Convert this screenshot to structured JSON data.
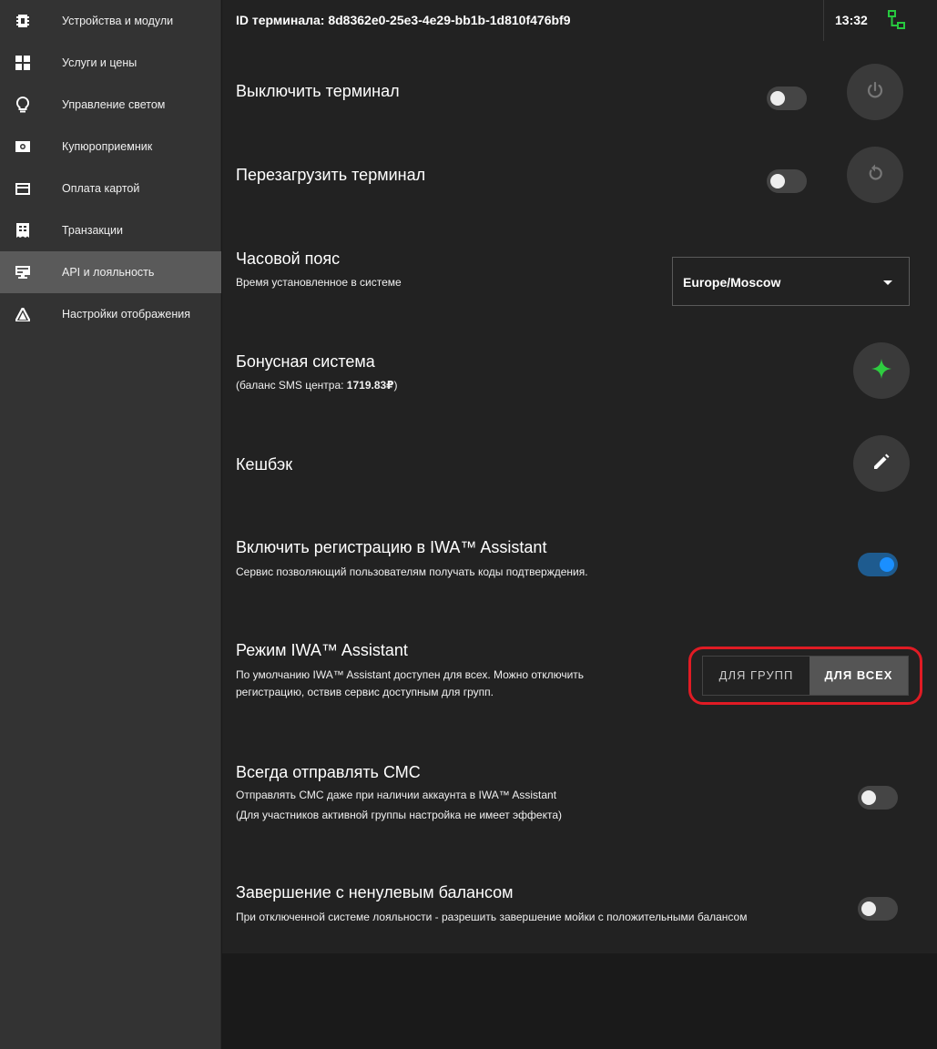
{
  "sidebar": {
    "items": [
      {
        "label": "Устройства и модули",
        "icon": "chip-icon",
        "active": false
      },
      {
        "label": "Услуги и цены",
        "icon": "grid-icon",
        "active": false
      },
      {
        "label": "Управление светом",
        "icon": "lightbulb-icon",
        "active": false
      },
      {
        "label": "Купюроприемник",
        "icon": "banknote-icon",
        "active": false
      },
      {
        "label": "Оплата картой",
        "icon": "credit-card-icon",
        "active": false
      },
      {
        "label": "Транзакции",
        "icon": "receipt-icon",
        "active": false
      },
      {
        "label": "API и лояльность",
        "icon": "api-icon",
        "active": true
      },
      {
        "label": "Настройки отображения",
        "icon": "display-settings-icon",
        "active": false
      }
    ]
  },
  "header": {
    "terminal_id": "ID терминала: 8d8362e0-25e3-4e29-bb1b-1d810f476bf9",
    "time": "13:32",
    "network_icon": "network-connected-icon",
    "network_color": "#27c93f"
  },
  "settings": {
    "shutdown": {
      "title": "Выключить терминал",
      "toggle_on": false,
      "button_icon": "power-icon"
    },
    "reboot": {
      "title": "Перезагрузить терминал",
      "toggle_on": false,
      "button_icon": "restart-icon"
    },
    "timezone": {
      "title": "Часовой пояс",
      "subtitle": "Время установленное в системе",
      "selected": "Europe/Moscow"
    },
    "bonus": {
      "title": "Бонусная система",
      "subtitle_prefix": "(баланс SMS центра: ",
      "balance": "1719.83₽",
      "subtitle_suffix": ")",
      "button_icon": "sparkle-icon",
      "accent": "#2ecc40"
    },
    "cashback": {
      "title": "Кешбэк",
      "button_icon": "pencil-icon"
    },
    "iwa_registration": {
      "title": "Включить регистрацию в IWA™ Assistant",
      "subtitle": "Сервис позволяющий пользователям получать коды подтверждения.",
      "toggle_on": true
    },
    "iwa_mode": {
      "title": "Режим IWA™ Assistant",
      "subtitle_line1": "По умолчанию IWA™ Assistant доступен для всех. Можно отключить",
      "subtitle_line2": "регистрацию, оствив сервис доступным для групп.",
      "options": [
        "ДЛЯ ГРУПП",
        "ДЛЯ ВСЕХ"
      ],
      "selected": "ДЛЯ ВСЕХ",
      "highlight_color": "#e01b24"
    },
    "always_sms": {
      "title": "Всегда отправлять СМС",
      "subtitle_line1": "Отправлять СМС даже при наличии аккаунта в IWA™ Assistant",
      "subtitle_line2": "(Для участников активной группы настройка не имеет эффекта)",
      "toggle_on": false
    },
    "nonzero_balance": {
      "title": "Завершение с ненулевым балансом",
      "subtitle": "При отключенной системе лояльности - разрешить завершение мойки с положительными балансом",
      "toggle_on": false
    }
  }
}
